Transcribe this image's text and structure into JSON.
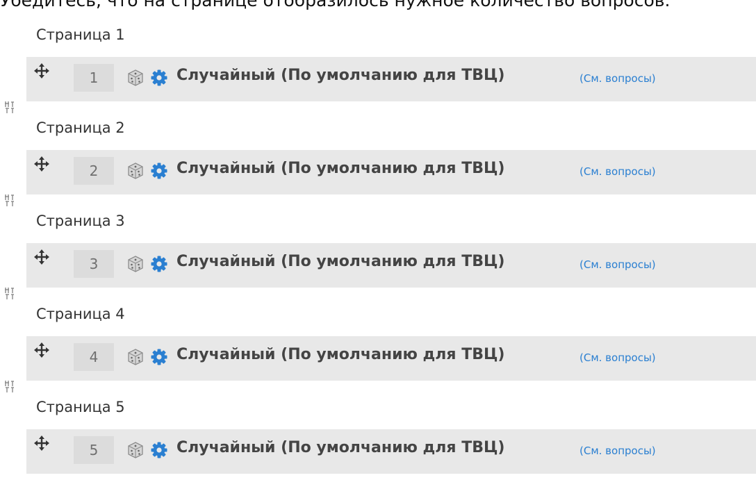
{
  "instruction": "Убедитесь, что на странице отобразилось нужное количество вопросов.",
  "pages": [
    {
      "header": "Страница 1",
      "slot": {
        "number": "1",
        "title": "Случайный (По умолчанию для ТВЦ)",
        "link": "(См. вопросы)",
        "icons": [
          "move-icon",
          "dice-icon",
          "gear-icon"
        ]
      },
      "repaginate_icon": "repaginate-icon"
    },
    {
      "header": "Страница 2",
      "slot": {
        "number": "2",
        "title": "Случайный (По умолчанию для ТВЦ)",
        "link": "(См. вопросы)",
        "icons": [
          "move-icon",
          "dice-icon",
          "gear-icon"
        ]
      },
      "repaginate_icon": "repaginate-icon"
    },
    {
      "header": "Страница 3",
      "slot": {
        "number": "3",
        "title": "Случайный (По умолчанию для ТВЦ)",
        "link": "(См. вопросы)",
        "icons": [
          "move-icon",
          "dice-icon",
          "gear-icon"
        ]
      },
      "repaginate_icon": "repaginate-icon"
    },
    {
      "header": "Страница 4",
      "slot": {
        "number": "4",
        "title": "Случайный (По умолчанию для ТВЦ)",
        "link": "(См. вопросы)",
        "icons": [
          "move-icon",
          "dice-icon",
          "gear-icon"
        ]
      },
      "repaginate_icon": "repaginate-icon"
    },
    {
      "header": "Страница 5",
      "slot": {
        "number": "5",
        "title": "Случайный (По умолчанию для ТВЦ)",
        "link": "(См. вопросы)",
        "icons": [
          "move-icon",
          "dice-icon",
          "gear-icon"
        ]
      }
    }
  ],
  "colors": {
    "row_background": "#e8e8e8",
    "number_background": "#dcdcdc",
    "gear": "#2a7fd1",
    "link": "#2a7fd1"
  }
}
